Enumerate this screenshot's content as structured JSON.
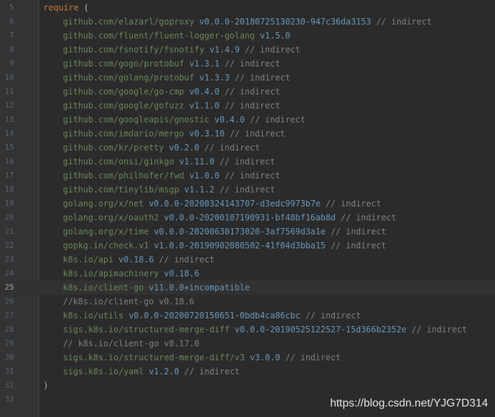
{
  "editor": {
    "lines": [
      {
        "num": "5",
        "indent": false,
        "parts": [
          {
            "t": "kw",
            "v": "require"
          },
          {
            "t": "plain",
            "v": " ("
          }
        ]
      },
      {
        "num": "6",
        "indent": true,
        "parts": [
          {
            "t": "pkg",
            "v": "github.com/elazarl/goproxy"
          },
          {
            "t": "plain",
            "v": " "
          },
          {
            "t": "ver",
            "v": "v0.0.0-20180725130230-947c36da3153"
          },
          {
            "t": "plain",
            "v": " "
          },
          {
            "t": "cmt",
            "v": "// indirect"
          }
        ]
      },
      {
        "num": "7",
        "indent": true,
        "parts": [
          {
            "t": "pkg",
            "v": "github.com/fluent/fluent-logger-golang"
          },
          {
            "t": "plain",
            "v": " "
          },
          {
            "t": "ver",
            "v": "v1.5.0"
          }
        ]
      },
      {
        "num": "8",
        "indent": true,
        "parts": [
          {
            "t": "pkg",
            "v": "github.com/fsnotify/fsnotify"
          },
          {
            "t": "plain",
            "v": " "
          },
          {
            "t": "ver",
            "v": "v1.4.9"
          },
          {
            "t": "plain",
            "v": " "
          },
          {
            "t": "cmt",
            "v": "// indirect"
          }
        ]
      },
      {
        "num": "9",
        "indent": true,
        "parts": [
          {
            "t": "pkg",
            "v": "github.com/gogo/protobuf"
          },
          {
            "t": "plain",
            "v": " "
          },
          {
            "t": "ver",
            "v": "v1.3.1"
          },
          {
            "t": "plain",
            "v": " "
          },
          {
            "t": "cmt",
            "v": "// indirect"
          }
        ]
      },
      {
        "num": "10",
        "indent": true,
        "parts": [
          {
            "t": "pkg",
            "v": "github.com/golang/protobuf"
          },
          {
            "t": "plain",
            "v": " "
          },
          {
            "t": "ver",
            "v": "v1.3.3"
          },
          {
            "t": "plain",
            "v": " "
          },
          {
            "t": "cmt",
            "v": "// indirect"
          }
        ]
      },
      {
        "num": "11",
        "indent": true,
        "parts": [
          {
            "t": "pkg",
            "v": "github.com/google/go-cmp"
          },
          {
            "t": "plain",
            "v": " "
          },
          {
            "t": "ver",
            "v": "v0.4.0"
          },
          {
            "t": "plain",
            "v": " "
          },
          {
            "t": "cmt",
            "v": "// indirect"
          }
        ]
      },
      {
        "num": "12",
        "indent": true,
        "parts": [
          {
            "t": "pkg",
            "v": "github.com/google/gofuzz"
          },
          {
            "t": "plain",
            "v": " "
          },
          {
            "t": "ver",
            "v": "v1.1.0"
          },
          {
            "t": "plain",
            "v": " "
          },
          {
            "t": "cmt",
            "v": "// indirect"
          }
        ]
      },
      {
        "num": "13",
        "indent": true,
        "parts": [
          {
            "t": "pkg",
            "v": "github.com/googleapis/gnostic"
          },
          {
            "t": "plain",
            "v": " "
          },
          {
            "t": "ver",
            "v": "v0.4.0"
          },
          {
            "t": "plain",
            "v": " "
          },
          {
            "t": "cmt",
            "v": "// indirect"
          }
        ]
      },
      {
        "num": "14",
        "indent": true,
        "parts": [
          {
            "t": "pkg",
            "v": "github.com/imdario/mergo"
          },
          {
            "t": "plain",
            "v": " "
          },
          {
            "t": "ver",
            "v": "v0.3.10"
          },
          {
            "t": "plain",
            "v": " "
          },
          {
            "t": "cmt",
            "v": "// indirect"
          }
        ]
      },
      {
        "num": "15",
        "indent": true,
        "parts": [
          {
            "t": "pkg",
            "v": "github.com/kr/pretty"
          },
          {
            "t": "plain",
            "v": " "
          },
          {
            "t": "ver",
            "v": "v0.2.0"
          },
          {
            "t": "plain",
            "v": " "
          },
          {
            "t": "cmt",
            "v": "// indirect"
          }
        ]
      },
      {
        "num": "16",
        "indent": true,
        "parts": [
          {
            "t": "pkg",
            "v": "github.com/onsi/ginkgo"
          },
          {
            "t": "plain",
            "v": " "
          },
          {
            "t": "ver",
            "v": "v1.11.0"
          },
          {
            "t": "plain",
            "v": " "
          },
          {
            "t": "cmt",
            "v": "// indirect"
          }
        ]
      },
      {
        "num": "17",
        "indent": true,
        "parts": [
          {
            "t": "pkg",
            "v": "github.com/philhofer/fwd"
          },
          {
            "t": "plain",
            "v": " "
          },
          {
            "t": "ver",
            "v": "v1.0.0"
          },
          {
            "t": "plain",
            "v": " "
          },
          {
            "t": "cmt",
            "v": "// indirect"
          }
        ]
      },
      {
        "num": "18",
        "indent": true,
        "parts": [
          {
            "t": "pkg",
            "v": "github.com/tinylib/msgp"
          },
          {
            "t": "plain",
            "v": " "
          },
          {
            "t": "ver",
            "v": "v1.1.2"
          },
          {
            "t": "plain",
            "v": " "
          },
          {
            "t": "cmt",
            "v": "// indirect"
          }
        ]
      },
      {
        "num": "19",
        "indent": true,
        "parts": [
          {
            "t": "pkg",
            "v": "golang.org/x/net"
          },
          {
            "t": "plain",
            "v": " "
          },
          {
            "t": "ver",
            "v": "v0.0.0-20200324143707-d3edc9973b7e"
          },
          {
            "t": "plain",
            "v": " "
          },
          {
            "t": "cmt",
            "v": "// indirect"
          }
        ]
      },
      {
        "num": "20",
        "indent": true,
        "parts": [
          {
            "t": "pkg",
            "v": "golang.org/x/oauth2"
          },
          {
            "t": "plain",
            "v": " "
          },
          {
            "t": "ver",
            "v": "v0.0.0-20200107190931-bf48bf16ab8d"
          },
          {
            "t": "plain",
            "v": " "
          },
          {
            "t": "cmt",
            "v": "// indirect"
          }
        ]
      },
      {
        "num": "21",
        "indent": true,
        "parts": [
          {
            "t": "pkg",
            "v": "golang.org/x/time"
          },
          {
            "t": "plain",
            "v": " "
          },
          {
            "t": "ver",
            "v": "v0.0.0-20200630173020-3af7569d3a1e"
          },
          {
            "t": "plain",
            "v": " "
          },
          {
            "t": "cmt",
            "v": "// indirect"
          }
        ]
      },
      {
        "num": "22",
        "indent": true,
        "parts": [
          {
            "t": "pkg",
            "v": "gopkg.in/check.v1"
          },
          {
            "t": "plain",
            "v": " "
          },
          {
            "t": "ver",
            "v": "v1.0.0-20190902080502-41f04d3bba15"
          },
          {
            "t": "plain",
            "v": " "
          },
          {
            "t": "cmt",
            "v": "// indirect"
          }
        ]
      },
      {
        "num": "23",
        "indent": true,
        "parts": [
          {
            "t": "pkg",
            "v": "k8s.io/api"
          },
          {
            "t": "plain",
            "v": " "
          },
          {
            "t": "ver",
            "v": "v0.18.6"
          },
          {
            "t": "plain",
            "v": " "
          },
          {
            "t": "cmt",
            "v": "// indirect"
          }
        ]
      },
      {
        "num": "24",
        "indent": true,
        "parts": [
          {
            "t": "pkg",
            "v": "k8s.io/apimachinery"
          },
          {
            "t": "plain",
            "v": " "
          },
          {
            "t": "ver",
            "v": "v0.18.6"
          }
        ]
      },
      {
        "num": "25",
        "indent": true,
        "current": true,
        "parts": [
          {
            "t": "pkg",
            "v": "k8s.io/client-go"
          },
          {
            "t": "plain",
            "v": " "
          },
          {
            "t": "ver",
            "v": "v11.0.0+incompatible"
          }
        ]
      },
      {
        "num": "26",
        "indent": true,
        "parts": [
          {
            "t": "cmt",
            "v": "//k8s.io/client-go v0.18.6"
          }
        ]
      },
      {
        "num": "27",
        "indent": true,
        "parts": [
          {
            "t": "pkg",
            "v": "k8s.io/utils"
          },
          {
            "t": "plain",
            "v": " "
          },
          {
            "t": "ver",
            "v": "v0.0.0-20200720150651-0bdb4ca86cbc"
          },
          {
            "t": "plain",
            "v": " "
          },
          {
            "t": "cmt",
            "v": "// indirect"
          }
        ]
      },
      {
        "num": "28",
        "indent": true,
        "parts": [
          {
            "t": "pkg",
            "v": "sigs.k8s.io/structured-merge-diff"
          },
          {
            "t": "plain",
            "v": " "
          },
          {
            "t": "ver",
            "v": "v0.0.0-20190525122527-15d366b2352e"
          },
          {
            "t": "plain",
            "v": " "
          },
          {
            "t": "cmt",
            "v": "// indirect"
          }
        ]
      },
      {
        "num": "29",
        "indent": true,
        "parts": [
          {
            "t": "cmt",
            "v": "// k8s.io/client-go v0.17.0"
          }
        ]
      },
      {
        "num": "30",
        "indent": true,
        "parts": [
          {
            "t": "pkg",
            "v": "sigs.k8s.io/structured-merge-diff/v3"
          },
          {
            "t": "plain",
            "v": " "
          },
          {
            "t": "ver",
            "v": "v3.0.0"
          },
          {
            "t": "plain",
            "v": " "
          },
          {
            "t": "cmt",
            "v": "// indirect"
          }
        ]
      },
      {
        "num": "31",
        "indent": true,
        "parts": [
          {
            "t": "pkg",
            "v": "sigs.k8s.io/yaml"
          },
          {
            "t": "plain",
            "v": " "
          },
          {
            "t": "ver",
            "v": "v1.2.0"
          },
          {
            "t": "plain",
            "v": " "
          },
          {
            "t": "cmt",
            "v": "// indirect"
          }
        ]
      },
      {
        "num": "32",
        "indent": false,
        "parts": [
          {
            "t": "plain",
            "v": ")"
          }
        ]
      },
      {
        "num": "33",
        "indent": false,
        "parts": []
      }
    ]
  },
  "watermark": "https://blog.csdn.net/YJG7D314",
  "colors": {
    "background": "#2b2b2b",
    "gutter": "#313335",
    "keyword": "#cc7832",
    "package": "#6a8759",
    "version": "#6897bb",
    "comment": "#808080"
  }
}
